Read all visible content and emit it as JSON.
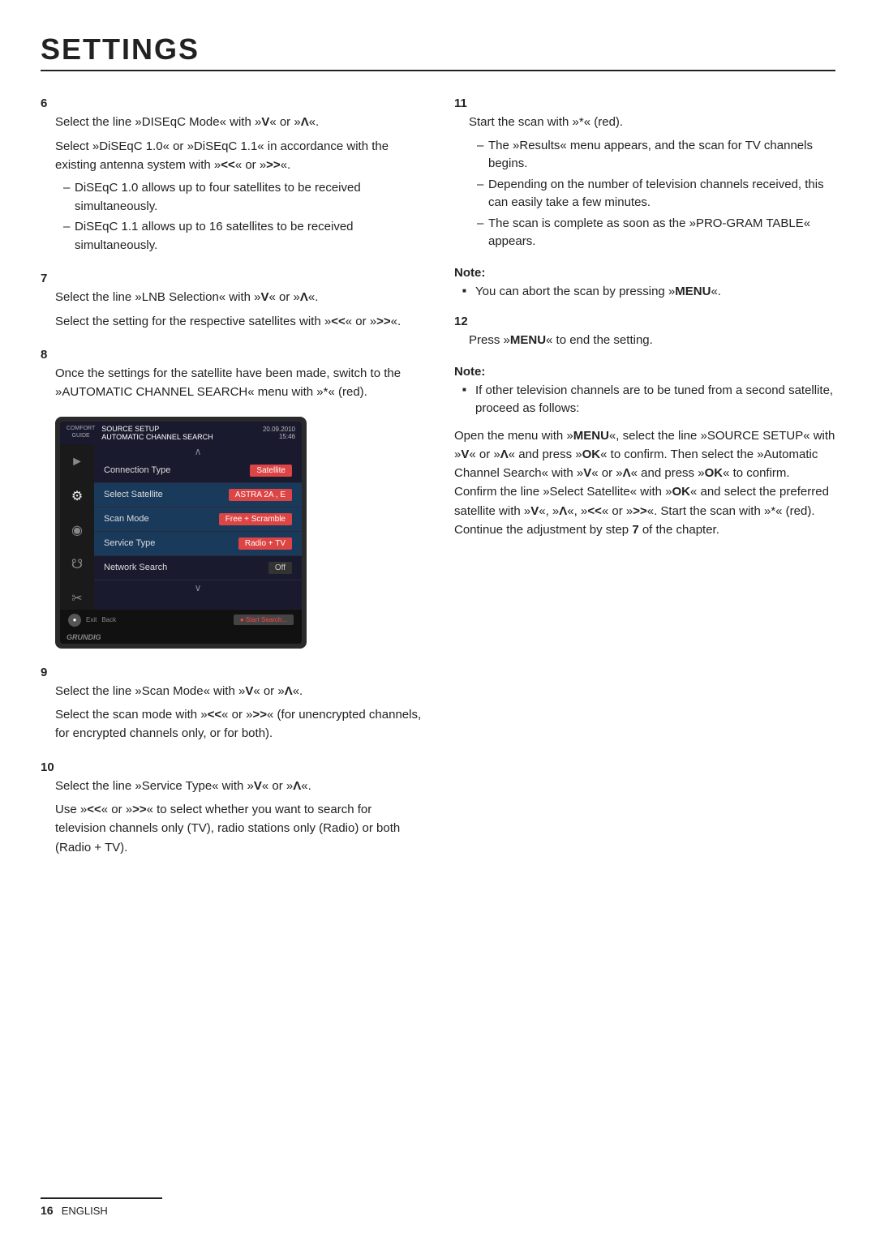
{
  "title": "SETTINGS",
  "page_number": "16",
  "page_label": "ENGLISH",
  "left_col": {
    "steps": [
      {
        "num": "6",
        "paragraphs": [
          "Select the line »DISEqC Mode« with »V« or »Λ«.",
          "Select »DiSEqC 1.0« or »DiSEqC 1.1« in accordance with the existing antenna system with »<« or »>«."
        ],
        "bullets": [
          "DiSEqC 1.0 allows up to four satellites to be received simultaneously.",
          "DiSEqC 1.1 allows up to 16 satellites to be received simultaneously."
        ]
      },
      {
        "num": "7",
        "paragraphs": [
          "Select the line »LNB Selection« with »V« or »Λ«.",
          "Select the setting for the respective satellites with »<« or »>«."
        ],
        "bullets": []
      },
      {
        "num": "8",
        "paragraphs": [
          "Once the settings for the satellite have been made, switch to the »AUTOMATIC CHANNEL SEARCH« menu with »*« (red)."
        ],
        "bullets": []
      }
    ]
  },
  "tv_screen": {
    "top_left": "COMFORT\nGUIDE",
    "source_setup": "SOURCE SETUP",
    "channel_search": "AUTOMATIC CHANNEL SEARCH",
    "date": "20.09.2010",
    "time": "15:46",
    "rows": [
      {
        "label": "Connection Type",
        "value": "Satellite",
        "style": "normal"
      },
      {
        "label": "Select Satellite",
        "value": "ASTRA 2A , E",
        "style": "highlighted"
      },
      {
        "label": "Scan Mode",
        "value": "Free + Scramble",
        "style": "highlighted"
      },
      {
        "label": "Service Type",
        "value": "Radio + TV",
        "style": "highlighted"
      },
      {
        "label": "Network Search",
        "value": "Off",
        "style": "dark"
      }
    ],
    "bottom_exit": "Exit",
    "bottom_back": "Back",
    "bottom_start": "● Start Search...",
    "logo": "GRUNDIG"
  },
  "right_col": {
    "steps": [
      {
        "num": "11",
        "paragraphs": [
          "Start the scan with »*« (red)."
        ],
        "bullets": [
          "The »Results« menu appears, and the scan for TV channels begins.",
          "Depending on the number of television channels received, this can easily take a few minutes.",
          "The scan is complete as soon as the »PRO-GRAM TABLE« appears."
        ]
      }
    ],
    "note1": {
      "label": "Note:",
      "items": [
        "You can abort the scan by pressing »MENU«."
      ]
    },
    "step12": {
      "num": "12",
      "text": "Press »MENU« to end the setting."
    },
    "note2": {
      "label": "Note:",
      "items": [
        "If other television channels are to be tuned from a second satellite, proceed as follows:"
      ]
    },
    "note2_paragraph": "Open the menu with »MENU«, select the line »SOURCE SETUP« with »V« or »Λ« and press »OK« to confirm. Then select the »Automatic Channel Search« with »V« or »Λ« and press »OK« to confirm. Confirm the line »Select Satellite« with »OK« and select the preferred satellite with »V«, »Λ«, »<« or »>«. Start the scan with »*« (red). Continue the adjustment by step 7 of the chapter.",
    "lower_steps": [
      {
        "num": "9",
        "paragraphs": [
          "Select the line »Scan Mode« with »V« or »Λ«.",
          "Select the scan mode with »<« or »>« (for unencrypted channels, for encrypted channels only, or for both)."
        ]
      },
      {
        "num": "10",
        "paragraphs": [
          "Select the line »Service Type« with »V« or »Λ«.",
          "Use »<« or »>« to select whether you want to search for television channels only (TV), radio stations only (Radio) or both (Radio + TV)."
        ]
      }
    ]
  }
}
